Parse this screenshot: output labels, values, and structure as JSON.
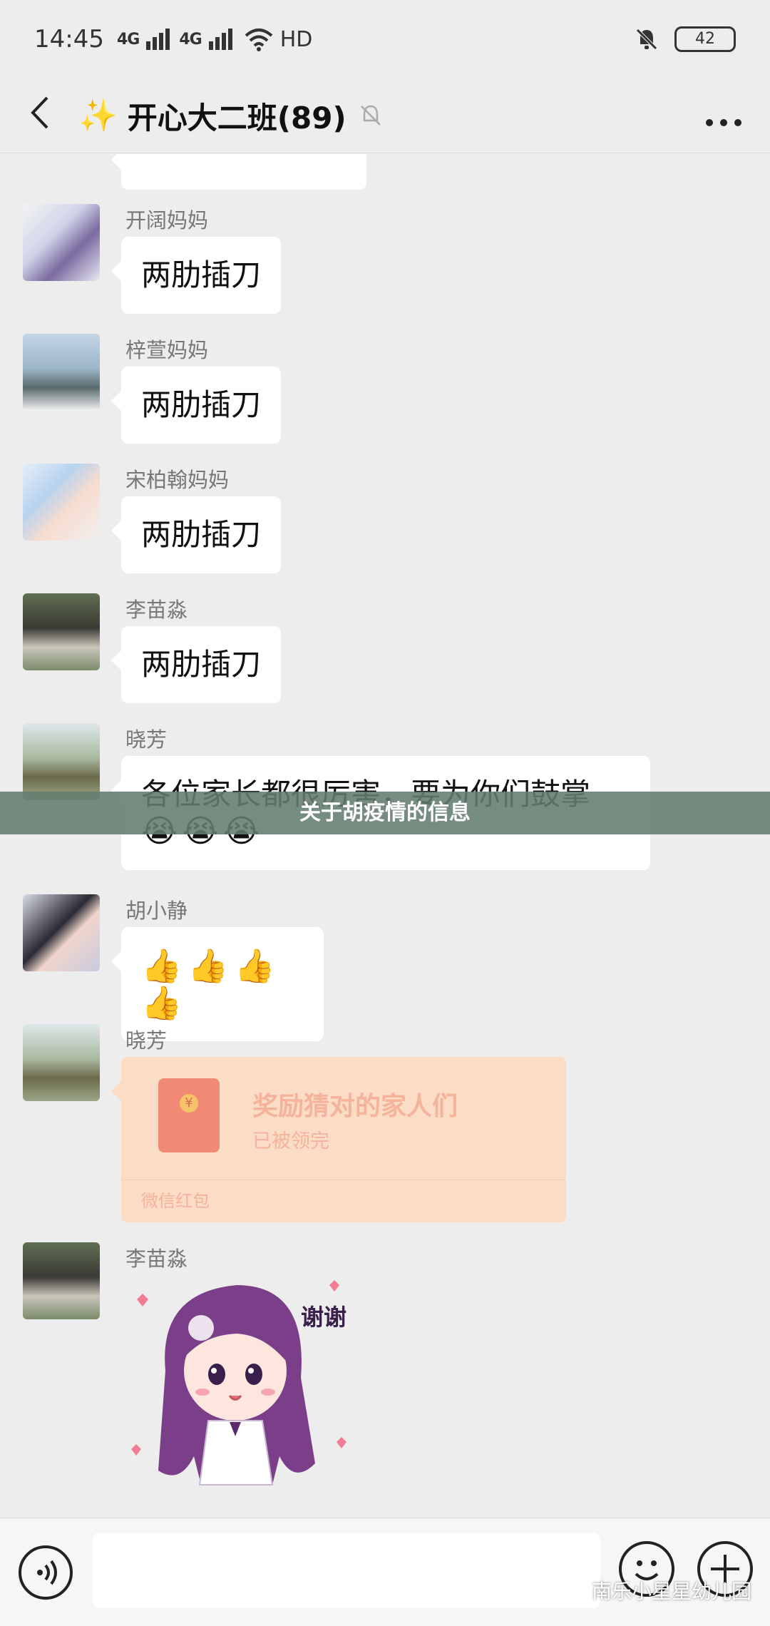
{
  "status_bar": {
    "time": "14:45",
    "signal1": "4G",
    "signal2": "4G",
    "hd": "HD",
    "battery": "42"
  },
  "header": {
    "title": "开心大二班(89)"
  },
  "messages": [
    {
      "sender": "开阔妈妈",
      "text": "两肋插刀"
    },
    {
      "sender": "梓萱妈妈",
      "text": "两肋插刀"
    },
    {
      "sender": "宋柏翰妈妈",
      "text": "两肋插刀"
    },
    {
      "sender": "李苗淼",
      "text": "两肋插刀"
    },
    {
      "sender": "晓芳",
      "text": "各位家长都很厉害，要为你们鼓掌",
      "emoji": "😭😭😭"
    },
    {
      "sender": "胡小静",
      "emoji": "👍👍👍👍"
    },
    {
      "sender": "晓芳"
    },
    {
      "sender": "李苗淼"
    }
  ],
  "red_packet": {
    "title": "奖励猜对的家人们",
    "status": "已被领完",
    "footer": "微信红包"
  },
  "sticker": {
    "text": "谢谢"
  },
  "banner": {
    "text": "关于胡疫情的信息"
  },
  "watermark": {
    "text": "南乐小星星幼儿园"
  }
}
